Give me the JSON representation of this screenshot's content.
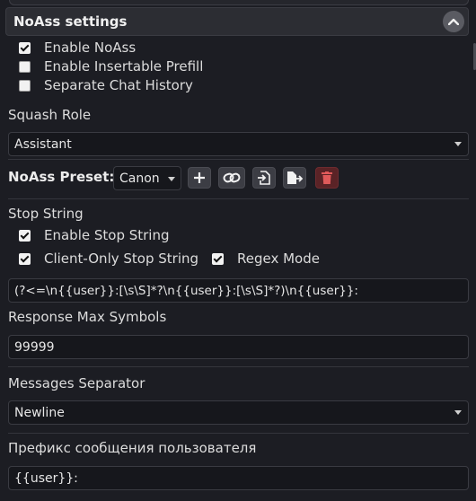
{
  "panel": {
    "title": "NoAss settings"
  },
  "checkboxes": {
    "enable_noass": {
      "label": "Enable NoAss",
      "checked": true
    },
    "enable_insertable_prefill": {
      "label": "Enable Insertable Prefill",
      "checked": false
    },
    "separate_chat_history": {
      "label": "Separate Chat History",
      "checked": false
    }
  },
  "squash_role": {
    "label": "Squash Role",
    "value": "Assistant"
  },
  "preset": {
    "label": "NoAss Preset:",
    "value": "Canon",
    "buttons": [
      "plus-icon",
      "link-icon",
      "import-icon",
      "export-icon",
      "trash-icon"
    ]
  },
  "stop_string": {
    "label": "Stop String",
    "enable": {
      "label": "Enable Stop String",
      "checked": true
    },
    "client_only": {
      "label": "Client-Only Stop String",
      "checked": true
    },
    "regex_mode": {
      "label": "Regex Mode",
      "checked": true
    },
    "value": "(?<=\\n{{user}}:[\\s\\S]*?\\n{{user}}:[\\s\\S]*?)\\n{{user}}:"
  },
  "response_max_symbols": {
    "label": "Response Max Symbols",
    "value": "99999"
  },
  "messages_separator": {
    "label": "Messages Separator",
    "value": "Newline"
  },
  "user_prefix": {
    "label": "Префикс сообщения пользователя",
    "value": "{{user}}:"
  },
  "colors": {
    "background": "#1c1d23",
    "field": "#16171c",
    "button": "#3c3d44",
    "danger": "#5a2326",
    "danger_icon": "#e05a5a"
  }
}
